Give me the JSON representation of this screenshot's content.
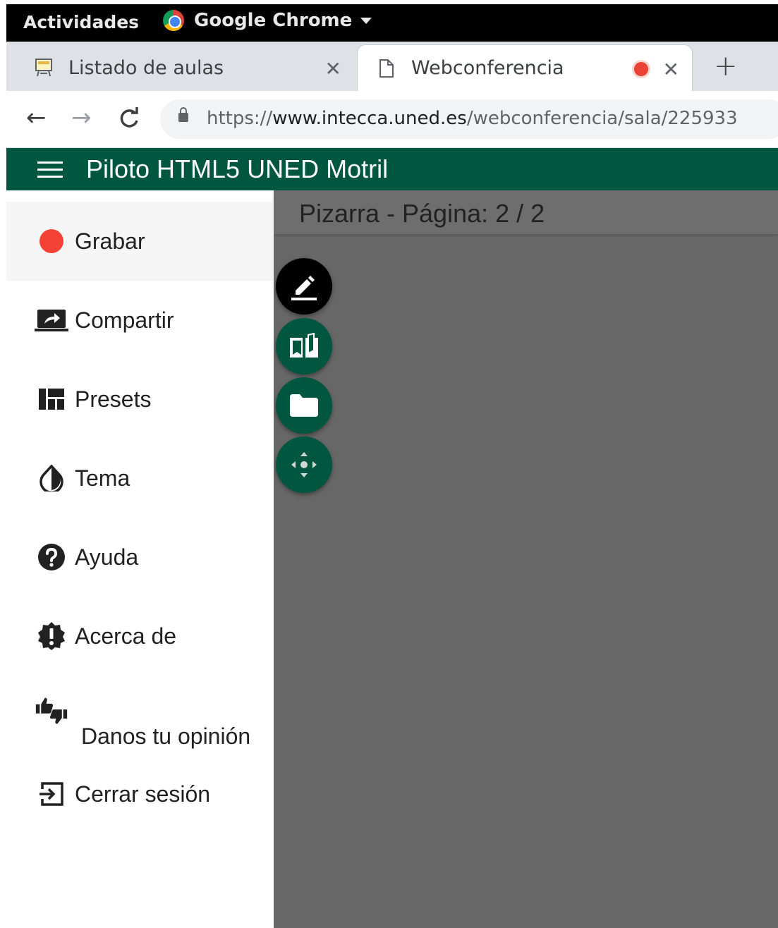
{
  "gnome": {
    "activities": "Actividades",
    "app_name": "Google Chrome"
  },
  "tabs": [
    {
      "title": "Listado de aulas",
      "icon": "classroom-icon"
    },
    {
      "title": "Webconferencia",
      "icon": "page-icon",
      "recording": true
    }
  ],
  "address_bar": {
    "scheme": "https://",
    "host": "www.intecca.uned.es",
    "path": "/webconferencia/sala/225933"
  },
  "app": {
    "title": "Piloto HTML5 UNED Motril",
    "accent_color": "#00563f"
  },
  "whiteboard": {
    "title": "Pizarra - Página: 2 / 2"
  },
  "fab_buttons": [
    {
      "icon": "pencil-icon"
    },
    {
      "icon": "book-icon"
    },
    {
      "icon": "folder-icon"
    },
    {
      "icon": "move-icon"
    }
  ],
  "menu": {
    "items": [
      {
        "label": "Grabar",
        "icon": "record-icon"
      },
      {
        "label": "Compartir",
        "icon": "share-screen-icon"
      },
      {
        "label": "Presets",
        "icon": "presets-icon"
      },
      {
        "label": "Tema",
        "icon": "theme-icon"
      },
      {
        "label": "Ayuda",
        "icon": "help-icon"
      },
      {
        "label": "Acerca de",
        "icon": "about-icon"
      },
      {
        "label": "Danos tu opinión",
        "icon": "thumbs-icon"
      },
      {
        "label": "Cerrar sesión",
        "icon": "logout-icon"
      }
    ]
  }
}
